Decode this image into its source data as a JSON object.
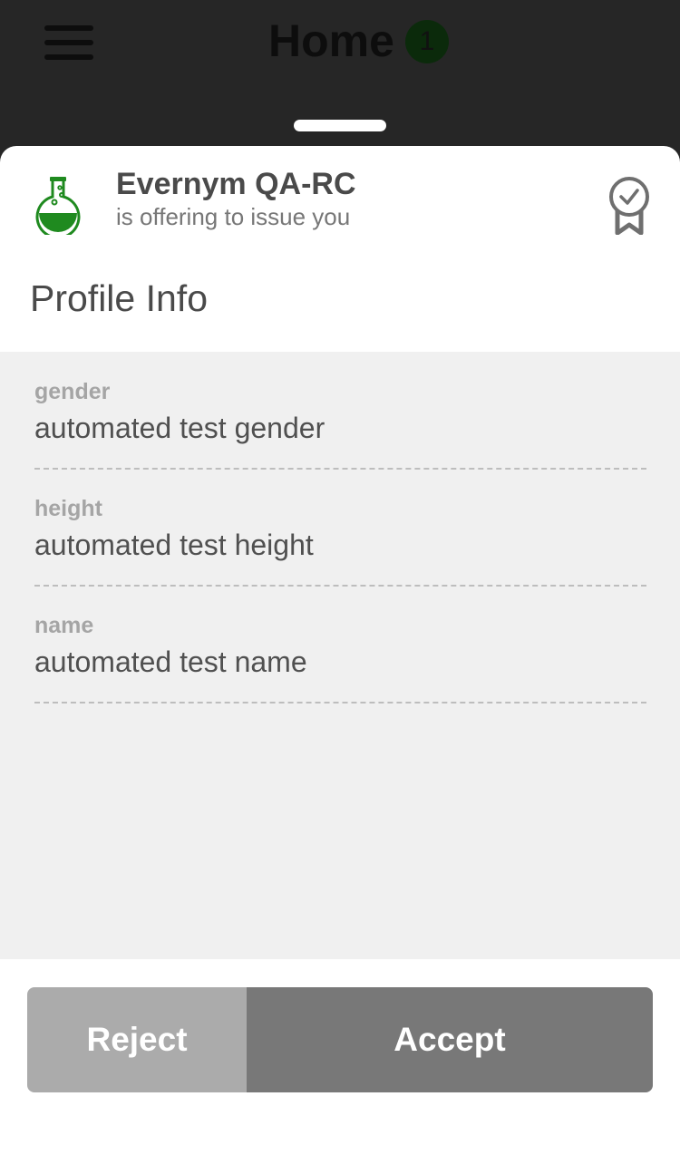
{
  "header": {
    "title": "Home",
    "badge_count": "1",
    "menu_icon": "hamburger-menu-icon"
  },
  "offer": {
    "issuer_name": "Evernym QA-RC",
    "subtitle": "is offering to issue you",
    "issuer_logo_icon": "flask-icon",
    "credential_icon": "award-ribbon-icon",
    "credential_title": "Profile Info"
  },
  "attributes": [
    {
      "label": "gender",
      "value": "automated test gender"
    },
    {
      "label": "height",
      "value": "automated test height"
    },
    {
      "label": "name",
      "value": "automated test name"
    }
  ],
  "actions": {
    "reject_label": "Reject",
    "accept_label": "Accept"
  },
  "colors": {
    "brand_green": "#1f8a1f",
    "reject_bg": "#ababab",
    "accept_bg": "#787878"
  }
}
